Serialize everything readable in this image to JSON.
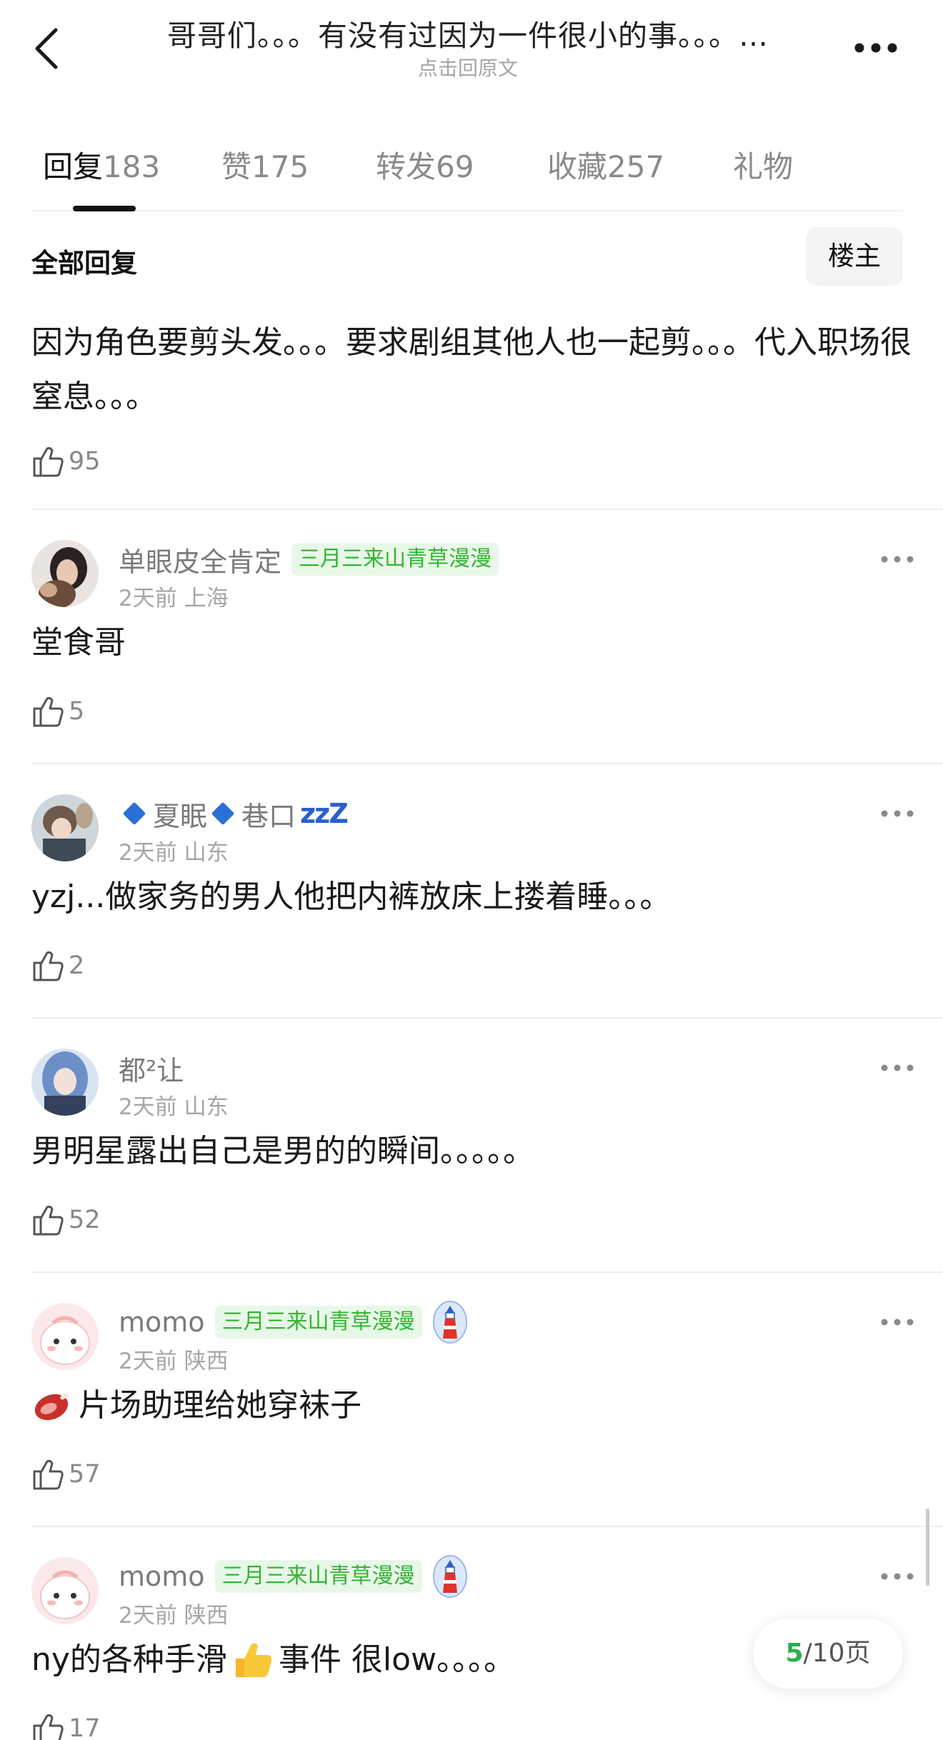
{
  "header": {
    "title": "哥哥们。。。有没有过因为一件很小的事。。。…",
    "subtitle": "点击回原文"
  },
  "tabs": [
    {
      "name": "回复",
      "count": "183"
    },
    {
      "name": "赞",
      "count": "175"
    },
    {
      "name": "转发",
      "count": "69"
    },
    {
      "name": "收藏",
      "count": "257"
    },
    {
      "name": "礼物",
      "count": ""
    }
  ],
  "filter": {
    "label": "全部回复",
    "owner_button": "楼主"
  },
  "first_comment": {
    "text": "因为角色要剪头发。。。要求剧组其他人也一起剪。。。代入职场很窒息。。。",
    "likes": "95"
  },
  "comments": [
    {
      "username": "单眼皮全肯定",
      "badge": "三月三来山青草漫漫",
      "time": "2天前",
      "location": "上海",
      "text": "堂食哥",
      "likes": "5"
    },
    {
      "username_a": "夏眠",
      "username_b": "巷口",
      "username_c": "zzZ",
      "time": "2天前",
      "location": "山东",
      "text": "yzj...做家务的男人他把内裤放床上搂着睡。。。",
      "likes": "2"
    },
    {
      "username": "都²让",
      "time": "2天前",
      "location": "山东",
      "text": "男明星露出自己是男的的瞬间。。。。。",
      "likes": "52"
    },
    {
      "username": "momo",
      "badge": "三月三来山青草漫漫",
      "time": "2天前",
      "location": "陕西",
      "text": "片场助理给她穿袜子",
      "likes": "57"
    },
    {
      "username": "momo",
      "badge": "三月三来山青草漫漫",
      "time": "2天前",
      "location": "陕西",
      "text_a": "ny的各种手滑",
      "text_b": "事件 很low。。。。",
      "likes": "17"
    }
  ],
  "pagination": {
    "current": "5",
    "total": "/10页"
  },
  "colors": {
    "badge_bg": "#e8f8e8",
    "badge_text": "#35b534",
    "page_current": "#2eae4a"
  }
}
